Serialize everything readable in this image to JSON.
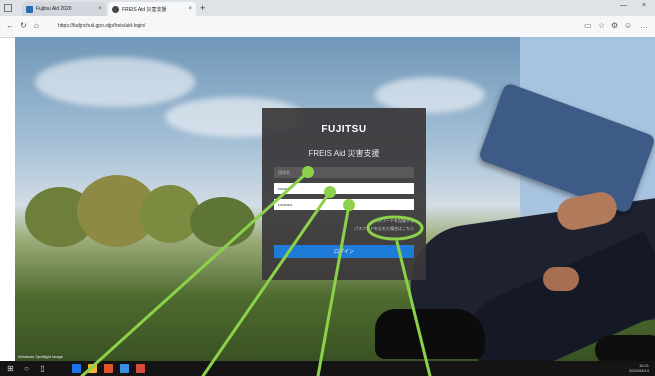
{
  "browser": {
    "tabs": [
      {
        "label": "Fujitsu Aid 2020"
      },
      {
        "label": "FREIS Aid 災害支援"
      }
    ],
    "new_tab": "+",
    "url": "https://fudjnchuii.gpo.stjp/freis/aid-login/"
  },
  "dialog": {
    "brand": "FUJITSU",
    "title": "FREIS Aid 災害支援",
    "field_org": {
      "placeholder": "団体名"
    },
    "field_user": {
      "value": "••••••••"
    },
    "field_pass": {
      "value": "••••••••••"
    },
    "option_1": "パスワードを記憶する",
    "option_2": "パスワードを忘れた場合はこちら",
    "login_label": "ログイン"
  },
  "taskbar": {
    "time": "10:21",
    "date": "2020/04/14"
  },
  "watermark": "Windows Spotlight image",
  "annotation_color": "#8bd24a"
}
